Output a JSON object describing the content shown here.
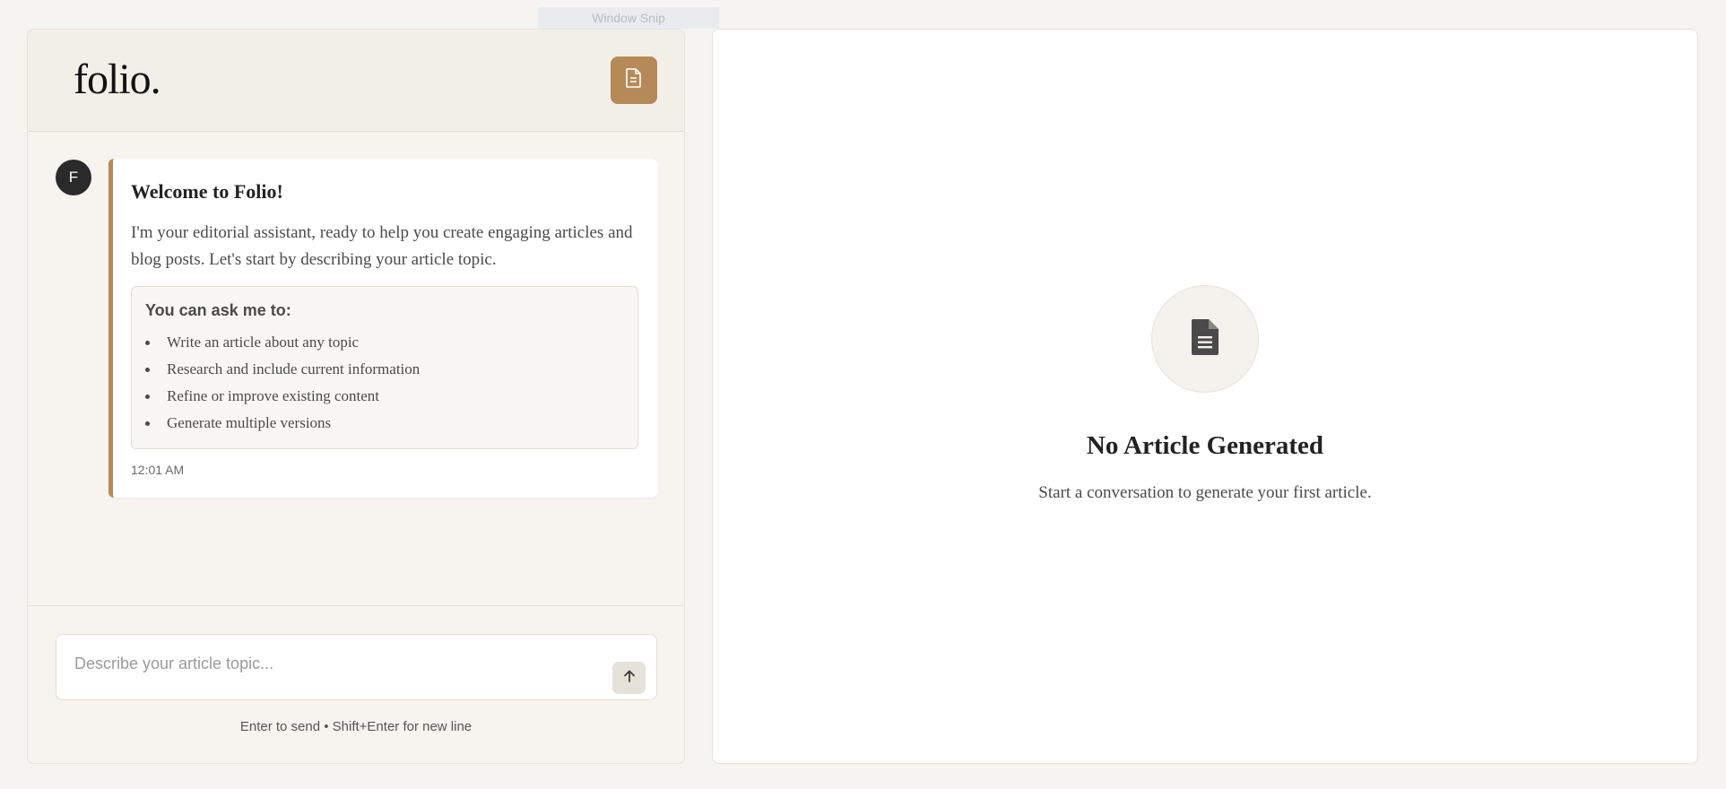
{
  "window": {
    "snip_label": "Window Snip"
  },
  "header": {
    "logo_text": "folio.",
    "doc_button_icon": "document-icon"
  },
  "message": {
    "avatar_letter": "F",
    "title": "Welcome to Folio!",
    "body": "I'm your editorial assistant, ready to help you create engaging articles and blog posts. Let's start by describing your article topic.",
    "hints_title": "You can ask me to:",
    "hints": [
      "Write an article about any topic",
      "Research and include current information",
      "Refine or improve existing content",
      "Generate multiple versions"
    ],
    "timestamp": "12:01 AM"
  },
  "composer": {
    "placeholder": "Describe your article topic...",
    "value": "",
    "send_icon": "arrow-up-icon",
    "hint": "Enter to send • Shift+Enter for new line"
  },
  "article": {
    "empty_icon": "document-icon",
    "empty_title": "No Article Generated",
    "empty_subtitle": "Start a conversation to generate your first article."
  },
  "colors": {
    "accent": "#b68a58",
    "background": "#f6f4f0",
    "panel": "#ffffff",
    "avatar": "#2a2a2a"
  }
}
